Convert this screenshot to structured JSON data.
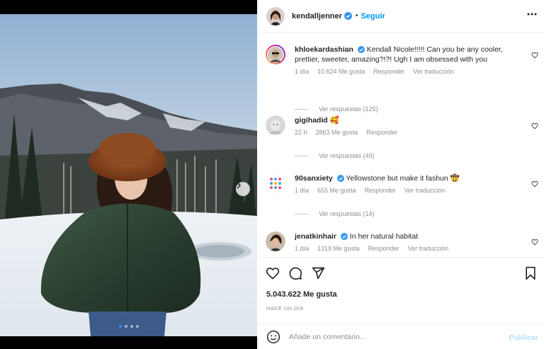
{
  "post": {
    "author": "kendalljenner",
    "follow_label": "Seguir",
    "separator": "•",
    "likes": "5.043.622 Me gusta",
    "time_ago": "HACE UN DÍA",
    "carousel_count": 4,
    "carousel_active": 0
  },
  "comments": [
    {
      "user": "khloekardashian",
      "verified": true,
      "text": "Kendall Nicole!!!!! Can you be any cooler, prettier, sweeter, amazing?!?!  Ugh I am obsessed with you",
      "time": "1 día",
      "likes": "10.624 Me gusta",
      "reply_label": "Responder",
      "translate_label": "Ver traducción",
      "replies_label": "Ver respuestas (125)"
    },
    {
      "user": "gigihadid",
      "verified": false,
      "text": "🥰",
      "time": "22 h",
      "likes": "2863 Me gusta",
      "reply_label": "Responder",
      "translate_label": "",
      "replies_label": "Ver respuestas (40)"
    },
    {
      "user": "90sanxiety",
      "verified": true,
      "text": "Yellowstone but make it fashun 🤠",
      "time": "1 día",
      "likes": "655 Me gusta",
      "reply_label": "Responder",
      "translate_label": "Ver traducción",
      "replies_label": "Ver respuestas (14)"
    },
    {
      "user": "jenatkinhair",
      "verified": true,
      "text": "In her natural habitat",
      "time": "1 día",
      "likes": "1319 Me gusta",
      "reply_label": "Responder",
      "translate_label": "Ver traducción",
      "replies_label": ""
    }
  ],
  "composer": {
    "placeholder": "Añade un comentario...",
    "publish_label": "Publicar"
  },
  "colors": {
    "accent": "#0095f6",
    "verified": "#3897f0",
    "muted": "#8e8e8e",
    "publish_disabled": "#b2dffc"
  },
  "icons": {
    "like": "heart-icon",
    "comment": "comment-icon",
    "share": "send-icon",
    "save": "bookmark-icon",
    "more": "more-options-icon",
    "emoji": "emoji-icon",
    "next": "chevron-right-icon"
  }
}
